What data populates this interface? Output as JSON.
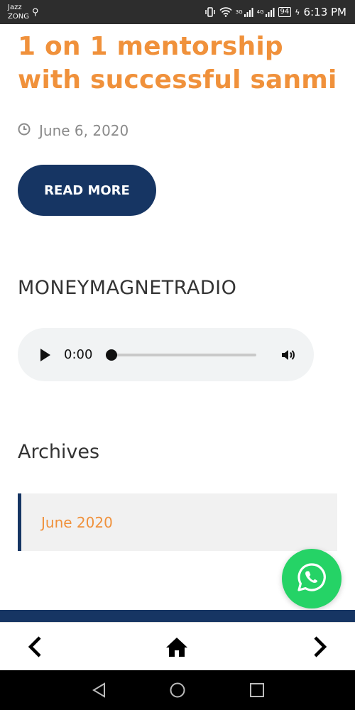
{
  "status_bar": {
    "carrier_line1": "Jazz",
    "carrier_line2": "ZONG",
    "signal1_label": "3G",
    "signal2_label": "4G",
    "battery": "94",
    "time": "6:13 PM"
  },
  "post": {
    "title": "1 on 1 mentorship with successful sanmi",
    "date": "June 6, 2020",
    "read_more_label": "READ MORE"
  },
  "radio_widget": {
    "title": "MONEYMAGNETRADIO",
    "player": {
      "current_time": "0:00",
      "progress": 0
    }
  },
  "archives_widget": {
    "title": "Archives",
    "items": [
      {
        "label": "June 2020"
      }
    ]
  },
  "colors": {
    "accent_orange": "#f0913b",
    "navy": "#163563",
    "whatsapp_green": "#25d366"
  },
  "icons": {
    "clock": "clock-icon",
    "whatsapp": "whatsapp-icon",
    "back": "chevron-left-icon",
    "home": "home-icon",
    "forward": "chevron-right-icon"
  }
}
